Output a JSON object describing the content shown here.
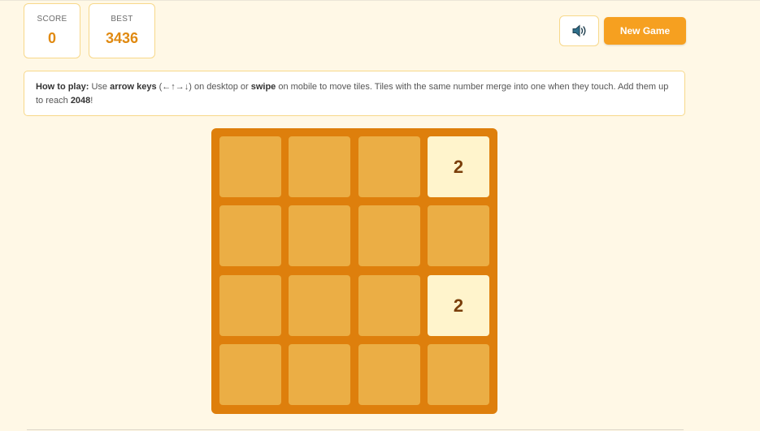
{
  "scoreboard": {
    "score_label": "SCORE",
    "score_value": "0",
    "best_label": "BEST",
    "best_value": "3436"
  },
  "controls": {
    "sound_icon": "speaker-icon",
    "new_game_label": "New Game"
  },
  "instructions": {
    "lead": "How to play:",
    "t1": " Use ",
    "arrow_keys": "arrow keys",
    "t2": " (←↑→↓) on desktop or ",
    "swipe": "swipe",
    "t3": " on mobile to move tiles. Tiles with the same number merge into one when they touch. Add them up to reach ",
    "goal": "2048",
    "t4": "!"
  },
  "board": {
    "size": 4,
    "rows": [
      [
        "",
        "",
        "",
        "2"
      ],
      [
        "",
        "",
        "",
        ""
      ],
      [
        "",
        "",
        "",
        "2"
      ],
      [
        "",
        "",
        "",
        ""
      ]
    ]
  },
  "colors": {
    "background": "#fff8e6",
    "board": "#de7f0c",
    "empty_cell": "#ebae45",
    "tile_2": "#fff4cc",
    "accent": "#f6a020",
    "score_value": "#e08a12"
  }
}
